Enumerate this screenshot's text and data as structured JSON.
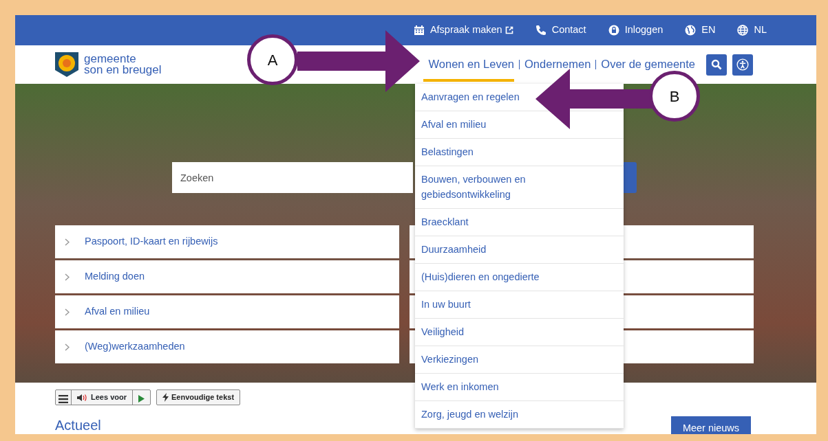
{
  "top_bar": [
    {
      "kind": "calendar",
      "label": "Afspraak maken"
    },
    {
      "kind": "phone",
      "label": "Contact"
    },
    {
      "kind": "lock",
      "label": "Inloggen"
    },
    {
      "kind": "globe-filled",
      "label": "EN"
    },
    {
      "kind": "globe",
      "label": "NL"
    }
  ],
  "logo": {
    "line1": "gemeente",
    "line2": "son en breugel"
  },
  "nav": [
    {
      "label": "Wonen en Leven",
      "selected": true
    },
    {
      "label": "Ondernemen",
      "selected": false
    },
    {
      "label": "Over de gemeente",
      "selected": false
    }
  ],
  "search": {
    "placeholder": "Zoeken"
  },
  "quick_links": [
    "Paspoort, ID-kaart en rijbewijs",
    "Melding doen",
    "Afval en milieu",
    "(Weg)werkzaamheden"
  ],
  "dropdown": [
    "Aanvragen en regelen",
    "Afval en milieu",
    "Belastingen",
    "Bouwen, verbouwen en gebiedsontwikkeling",
    "Braecklant",
    "Duurzaamheid",
    "(Huis)dieren en ongedierte",
    "In uw buurt",
    "Veiligheid",
    "Verkiezingen",
    "Werk en inkomen",
    "Zorg, jeugd en welzijn"
  ],
  "toolbar": {
    "read_aloud": "Lees voor",
    "simple_text": "Eenvoudige tekst"
  },
  "news": {
    "heading": "Actueel",
    "button": "Meer nieuws"
  },
  "annotations": [
    {
      "label": "A",
      "kind": "arrow-right"
    },
    {
      "label": "B",
      "kind": "arrow-left"
    }
  ]
}
